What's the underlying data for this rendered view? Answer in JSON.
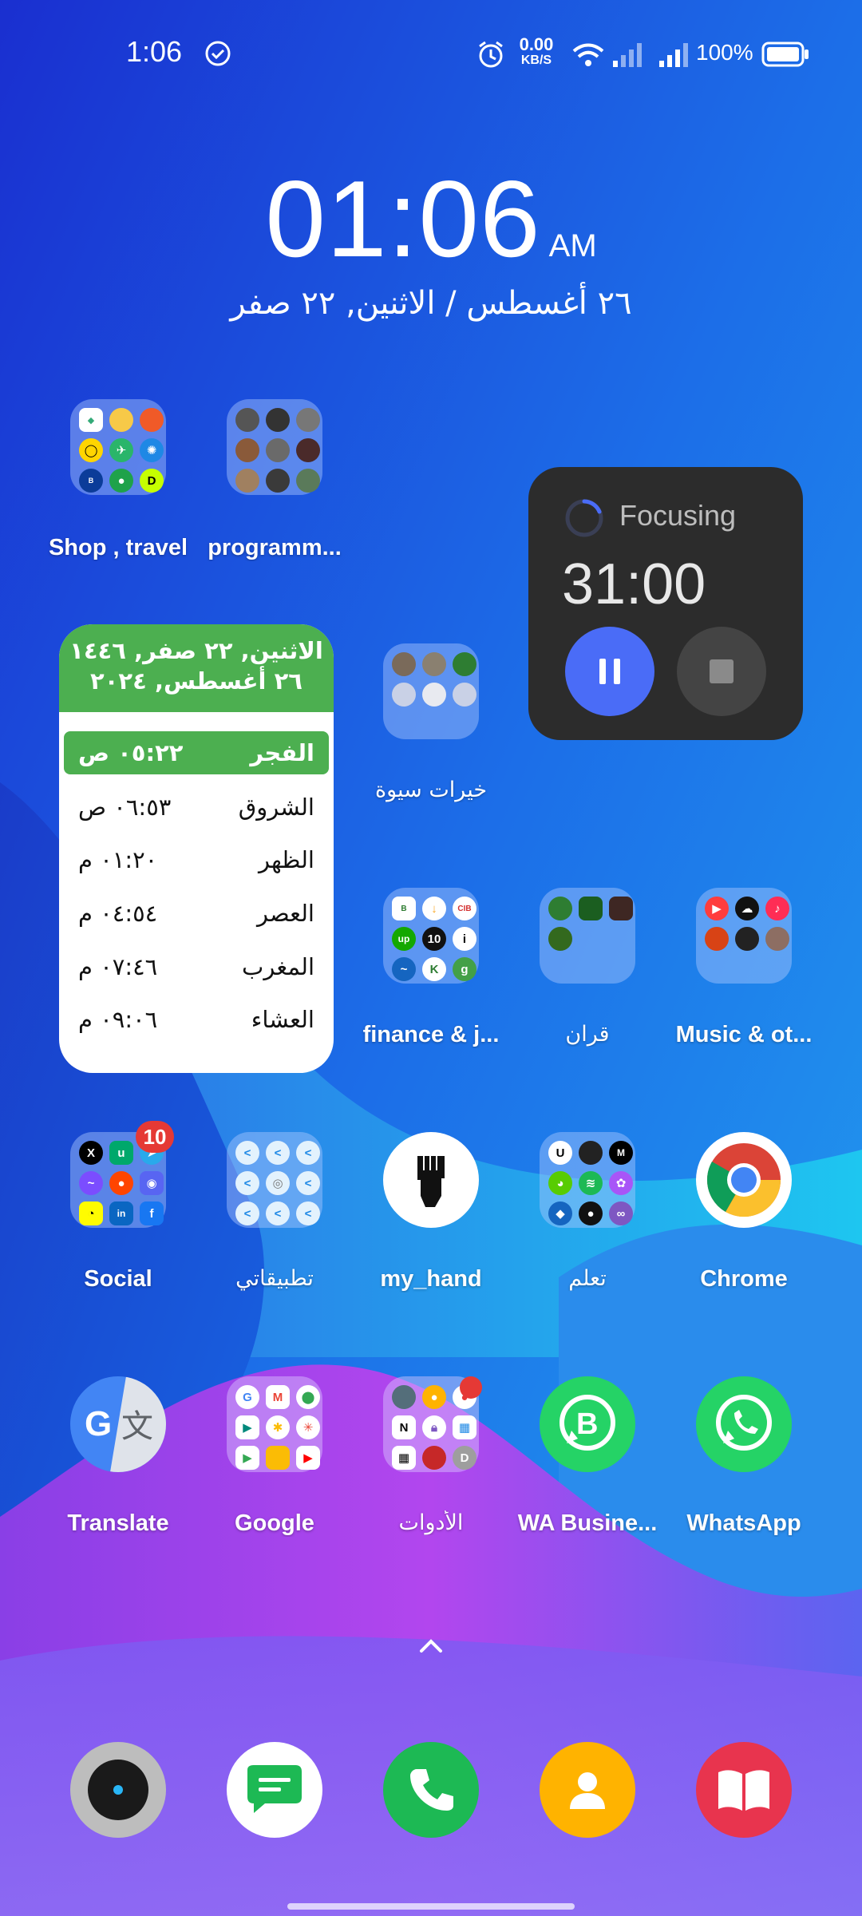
{
  "status_bar": {
    "time": "1:06",
    "net_speed_value": "0.00",
    "net_speed_unit": "KB/S",
    "battery": "100%"
  },
  "clock": {
    "time": "01:06",
    "ampm": "AM",
    "date": "٢٦ أغسطس / الاثنين, ٢٢ صفر"
  },
  "folders": {
    "shop_travel": "Shop , travel",
    "programming": "programm...",
    "khairat": "خيرات سيوة",
    "finance": "finance & j...",
    "quran": "قران",
    "music": "Music & ot...",
    "social": "Social",
    "my_apps": "تطبيقاتي",
    "learn": "تعلم",
    "google": "Google",
    "tools": "الأدوات"
  },
  "apps": {
    "my_hand": "my_hand",
    "chrome": "Chrome",
    "translate": "Translate",
    "wa_business": "WA Busine...",
    "whatsapp": "WhatsApp"
  },
  "badges": {
    "social_count": "10"
  },
  "prayer_widget": {
    "hijri_line": "الاثنين, ٢٢ صفر, ١٤٤٦",
    "gregorian_line": "٢٦ أغسطس, ٢٠٢٤",
    "prayers": [
      {
        "name": "الفجر",
        "time": "٠٥:٢٢ ص"
      },
      {
        "name": "الشروق",
        "time": "٠٦:٥٣ ص"
      },
      {
        "name": "الظهر",
        "time": "٠١:٢٠ م"
      },
      {
        "name": "العصر",
        "time": "٠٤:٥٤ م"
      },
      {
        "name": "المغرب",
        "time": "٠٧:٤٦ م"
      },
      {
        "name": "العشاء",
        "time": "٠٩:٠٦ م"
      }
    ]
  },
  "focus_widget": {
    "status": "Focusing",
    "time": "31:00"
  },
  "colors": {
    "prayer_green": "#4caf50",
    "focus_blue": "#4a6cf7",
    "badge_red": "#e53935",
    "whatsapp_green": "#25d366",
    "phone_green": "#1db954",
    "contacts_yellow": "#ffb300",
    "books_red": "#e8344e"
  }
}
